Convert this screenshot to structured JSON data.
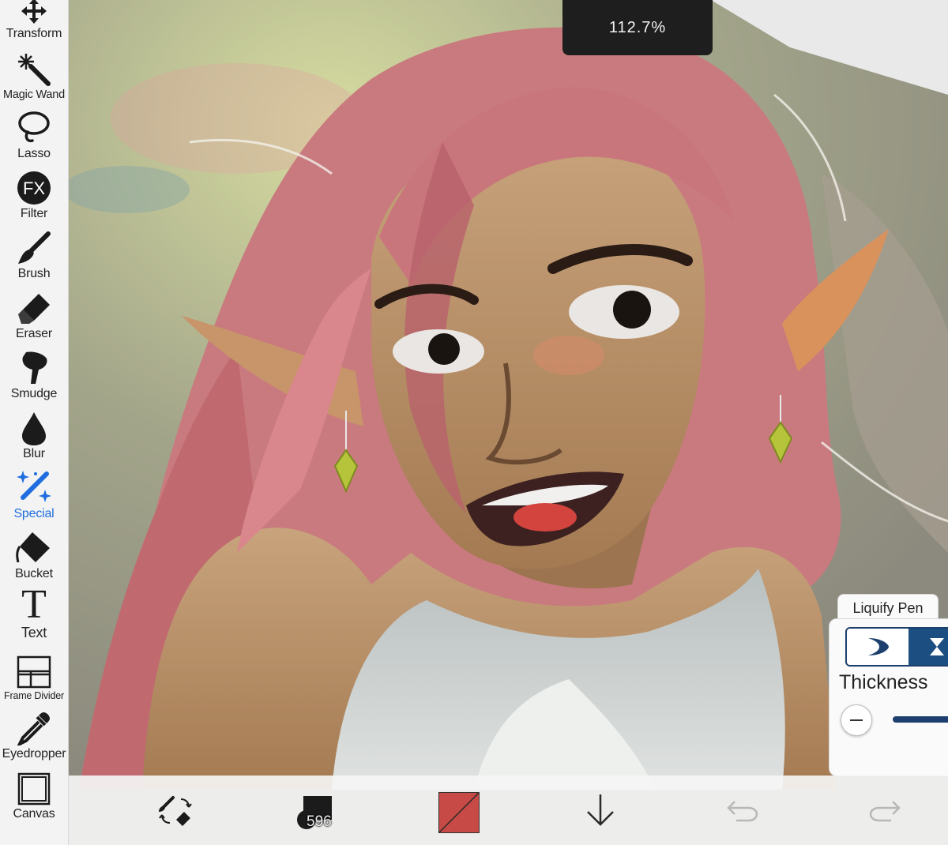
{
  "zoom": {
    "value": "112.7%"
  },
  "toolbar": {
    "tools": [
      {
        "id": "transform",
        "label": "Transform",
        "icon": "move-arrows-icon"
      },
      {
        "id": "magic-wand",
        "label": "Magic Wand",
        "icon": "magic-wand-icon"
      },
      {
        "id": "lasso",
        "label": "Lasso",
        "icon": "lasso-icon"
      },
      {
        "id": "filter",
        "label": "Filter",
        "icon": "fx-icon",
        "glyph": "FX"
      },
      {
        "id": "brush",
        "label": "Brush",
        "icon": "brush-icon"
      },
      {
        "id": "eraser",
        "label": "Eraser",
        "icon": "eraser-icon"
      },
      {
        "id": "smudge",
        "label": "Smudge",
        "icon": "smudge-finger-icon"
      },
      {
        "id": "blur",
        "label": "Blur",
        "icon": "droplet-icon"
      },
      {
        "id": "special",
        "label": "Special",
        "icon": "sparkle-pen-icon",
        "active": true
      },
      {
        "id": "bucket",
        "label": "Bucket",
        "icon": "bucket-icon"
      },
      {
        "id": "text",
        "label": "Text",
        "icon": "text-t-icon",
        "glyph": "T"
      },
      {
        "id": "frame-divider",
        "label": "Frame Divider",
        "icon": "frame-divider-icon"
      },
      {
        "id": "eyedropper",
        "label": "Eyedropper",
        "icon": "eyedropper-icon"
      },
      {
        "id": "canvas",
        "label": "Canvas",
        "icon": "canvas-square-icon"
      }
    ],
    "active_color": "#1f6ee0"
  },
  "liquify": {
    "tab_label": "Liquify Pen",
    "thickness_label": "Thickness",
    "accent": "#1c3f6e"
  },
  "bottombar": {
    "brush_size": "596",
    "main_color": "#c74a46",
    "icons": [
      "brush-eraser-swap-icon",
      "layer-down-arrow-icon",
      "undo-icon",
      "redo-icon"
    ]
  }
}
